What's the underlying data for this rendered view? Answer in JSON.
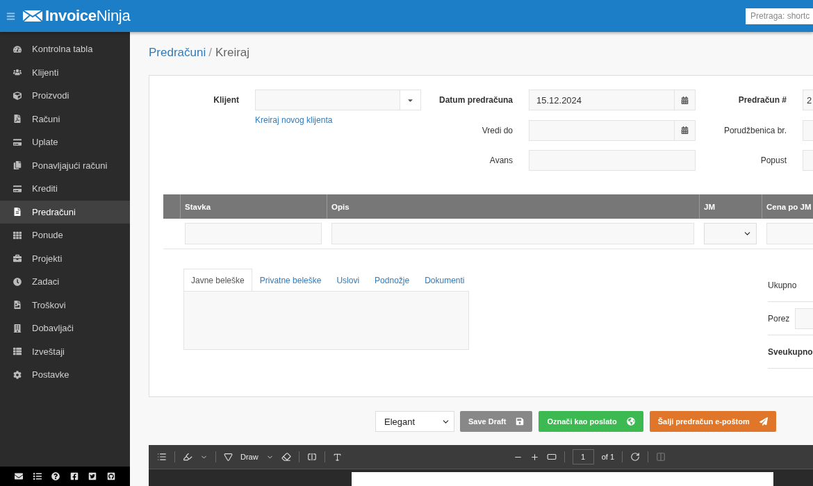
{
  "header": {
    "logo_text": "**Invoice**Ninja",
    "search": {
      "placeholder": "Pretraga: shortc"
    }
  },
  "sidebar": {
    "items": [
      {
        "label": "Kontrolna tabla",
        "selected": false
      },
      {
        "label": "Klijenti",
        "selected": false
      },
      {
        "label": "Proizvodi",
        "selected": false
      },
      {
        "label": "Računi",
        "selected": false
      },
      {
        "label": "Uplate",
        "selected": false
      },
      {
        "label": "Ponavljajući računi",
        "selected": false
      },
      {
        "label": "Krediti",
        "selected": false
      },
      {
        "label": "Predračuni",
        "selected": true
      },
      {
        "label": "Ponude",
        "selected": false
      },
      {
        "label": "Projekti",
        "selected": false
      },
      {
        "label": "Zadaci",
        "selected": false
      },
      {
        "label": "Troškovi",
        "selected": false
      },
      {
        "label": "Dobavljači",
        "selected": false
      },
      {
        "label": "Izveštaji",
        "selected": false
      },
      {
        "label": "Postavke",
        "selected": false
      }
    ]
  },
  "breadcrumb": {
    "parent": "Predračuni",
    "separator": "/",
    "current": "Kreiraj"
  },
  "form": {
    "client": {
      "label": "Klijent"
    },
    "create_client_link": "Kreiraj novog klijenta",
    "middle": [
      {
        "label": "Datum predračuna",
        "value": "15.12.2024",
        "kind": "date",
        "bold": true
      },
      {
        "label": "Vredi do",
        "kind": "date",
        "bold": false
      },
      {
        "label": "Avans",
        "kind": "text",
        "bold": false
      }
    ],
    "right": [
      {
        "label": "Predračun #",
        "value": "2",
        "bold": true
      },
      {
        "label": "Porudžbenica br.",
        "bold": false
      },
      {
        "label": "Popust",
        "bold": false
      }
    ]
  },
  "items_table": {
    "columns": [
      "Stavka",
      "Opis",
      "JM",
      "Cena po JM"
    ]
  },
  "notes_tabs": [
    {
      "label": "Javne beleške",
      "selected": true
    },
    {
      "label": "Privatne beleške",
      "selected": false
    },
    {
      "label": "Uslovi",
      "selected": false
    },
    {
      "label": "Podnožje",
      "selected": false
    },
    {
      "label": "Dokumenti",
      "selected": false
    }
  ],
  "totals": [
    {
      "label": "Ukupno",
      "kind": "plain"
    },
    {
      "label": "Porez",
      "kind": "input"
    },
    {
      "label": "Sveukupno",
      "kind": "bold"
    }
  ],
  "actions": {
    "design_select": "Elegant",
    "buttons": [
      {
        "label": "Save Draft",
        "kind": "default"
      },
      {
        "label": "Označi kao poslato",
        "kind": "success"
      },
      {
        "label": "Šalji predračun e-poštom",
        "kind": "primary"
      }
    ]
  },
  "pdf_viewer": {
    "draw_label": "Draw",
    "page": "1",
    "page_count": "of 1"
  }
}
